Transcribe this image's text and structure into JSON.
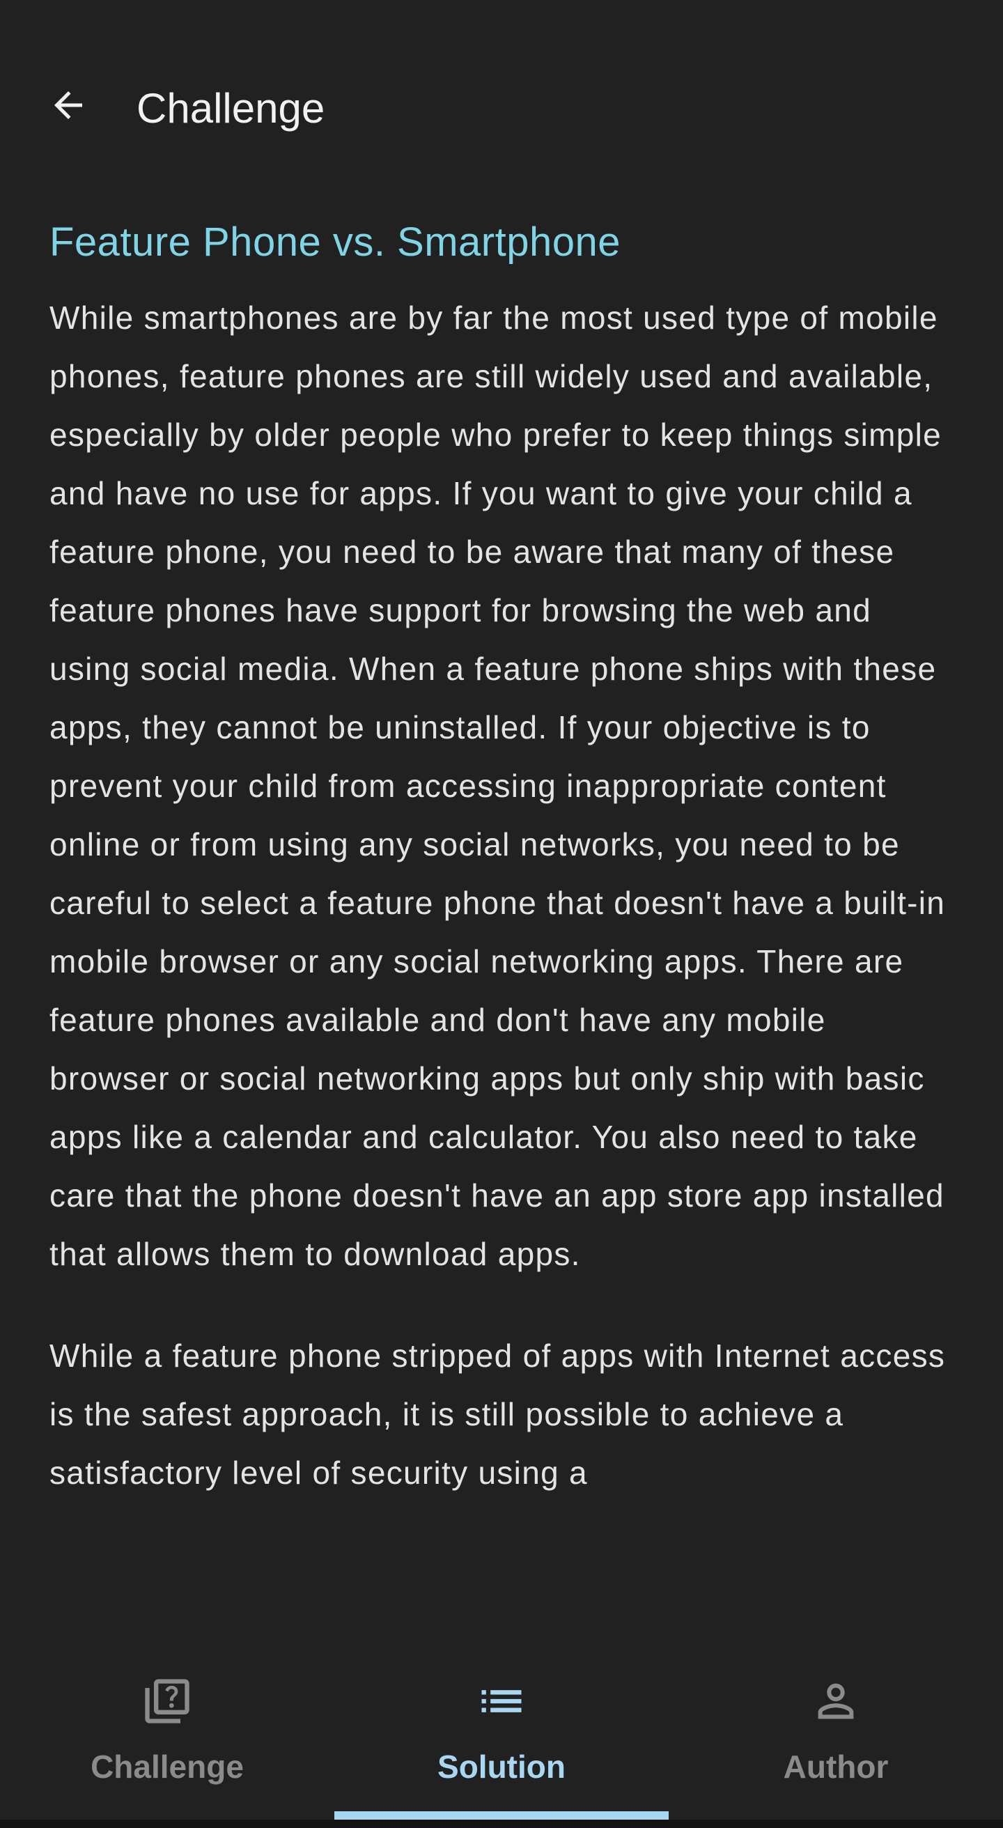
{
  "app_bar": {
    "title": "Challenge",
    "back_icon": "arrow-back-icon"
  },
  "content": {
    "heading": "Feature Phone vs. Smartphone",
    "paragraphs": [
      "While smartphones are by far the most used type of mobile phones, feature phones are still widely used and available, especially by older people who prefer to keep things simple and have no use for apps. If you want to give your child a feature phone, you need to be aware that many of these feature phones have support for browsing the web and using social media.  When a feature phone ships with these apps, they cannot be uninstalled. If your objective is to prevent your child from accessing inappropriate content online or from using any social networks, you need to be careful to select a feature phone that doesn't have a built-in mobile browser or any social networking apps. There are feature phones available and don't have any mobile browser or social networking apps but only ship with basic apps like a calendar and calculator. You also need to take care that the phone doesn't have an app store app installed that allows them to download apps.",
      "While a feature phone stripped of apps with Internet access is the safest approach, it is still possible to achieve a satisfactory level of security using a"
    ]
  },
  "bottom_nav": {
    "items": [
      {
        "label": "Challenge",
        "icon": "library-question-icon",
        "active": false
      },
      {
        "label": "Solution",
        "icon": "list-icon",
        "active": true
      },
      {
        "label": "Author",
        "icon": "person-icon",
        "active": false
      }
    ]
  },
  "colors": {
    "background": "#212121",
    "heading": "#7fd4e6",
    "active_nav": "#a9d6f0",
    "inactive_nav": "#8b8b8b",
    "text": "#e4e4e4"
  }
}
